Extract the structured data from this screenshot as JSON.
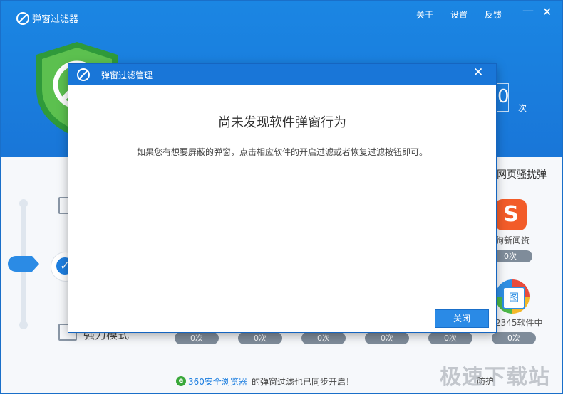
{
  "app": {
    "title": "弹窗过滤器"
  },
  "header_links": {
    "about": "关于",
    "settings": "设置",
    "feedback": "反馈"
  },
  "window_controls": {
    "minimize": "—",
    "close": "✕"
  },
  "stats": {
    "count": "0",
    "unit": "次"
  },
  "modes": {
    "strong_mode_label": "强力模式"
  },
  "right_panel": {
    "title": "网页骚扰弹",
    "apps": [
      {
        "name": "狗新闻资",
        "count": "0次",
        "icon": "sohu-icon"
      },
      {
        "name": "2345软件中",
        "count": "0次",
        "icon": "2345-icon"
      }
    ]
  },
  "pills": [
    "0次",
    "0次",
    "0次",
    "0次",
    "0次",
    "0次"
  ],
  "footer": {
    "browser_link": "360安全浏览器",
    "sync_text": "的弹窗过滤也已同步开启！",
    "bottom_fragment": "防护"
  },
  "watermark": "极速下载站",
  "modal": {
    "title": "弹窗过滤管理",
    "heading": "尚未发现软件弹窗行为",
    "message": "如果您有想要屏蔽的弹窗，点击相应软件的开启过滤或者恢复过滤按钮即可。",
    "close_button": "关闭",
    "close_icon": "✕"
  },
  "colors": {
    "header_blue": "#1b86e3",
    "shield_green": "#4cb748",
    "button_blue": "#2a8ae6"
  }
}
